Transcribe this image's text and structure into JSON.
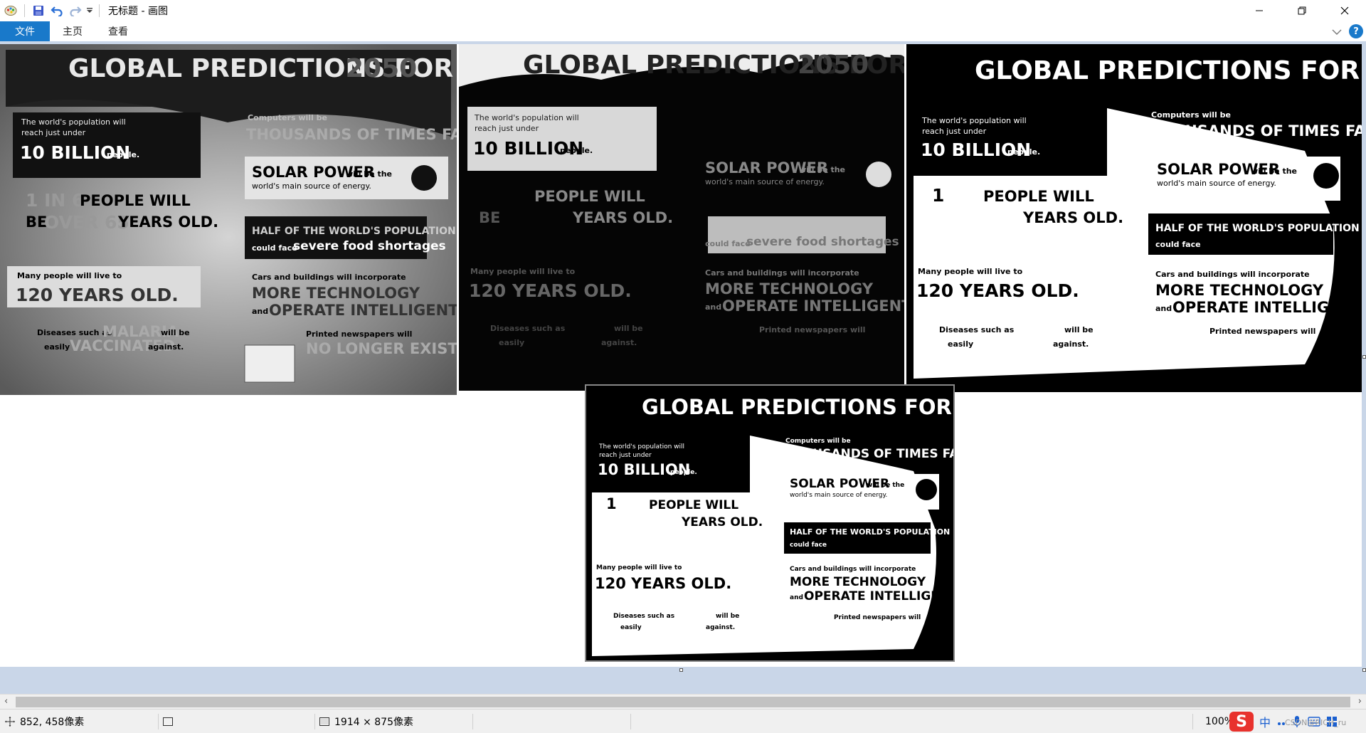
{
  "window": {
    "title": "无标题 - 画图"
  },
  "ribbon": {
    "tabs": [
      {
        "label": "文件"
      },
      {
        "label": "主页"
      },
      {
        "label": "查看"
      }
    ],
    "help_label": "?"
  },
  "infographic": {
    "title_short": "GLOBAL PREDICTIONS FOR",
    "title_year": "2050",
    "population_line1": "The world's population will",
    "population_line2": "reach just under",
    "billion": "10 BILLION",
    "people": "people.",
    "computers": "Computers will be",
    "thousands": "THOUSANDS OF TIMES FASTER.",
    "solar": "SOLAR POWER",
    "solar_suffix": "will be the",
    "solar_line2": "world's main source of energy.",
    "one_in_six": "1 IN 6",
    "people_will": "PEOPLE WILL",
    "be": "BE",
    "over65": "OVER 65",
    "years_old": "YEARS OLD.",
    "half_world": "HALF OF THE WORLD'S POPULATION",
    "could_face": "could face",
    "severe_food": "severe food shortages",
    "many_people": "Many people will live to",
    "years120": "120 YEARS OLD.",
    "cars_buildings": "Cars and buildings will incorporate",
    "more_tech": "MORE TECHNOLOGY",
    "and": "and",
    "operate": "OPERATE INTELLIGENTLY.",
    "diseases": "Diseases such as",
    "malaria": "MALARIA",
    "will_be": "will be",
    "easily": "easily",
    "vaccinated": "VACCINATED",
    "against": "against.",
    "printed": "Printed newspapers will",
    "no_longer": "NO LONGER EXIST.",
    "one": "1"
  },
  "status": {
    "cursor_pos": "852, 458像素",
    "image_size": "1914 × 875像素",
    "zoom": "100%",
    "ime_label": "中",
    "watermark": "CSDN@RICH_ru"
  },
  "colors": {
    "accent": "#1979ca",
    "workspace": "#c9d6e8",
    "statusbar": "#f0f0f0"
  }
}
